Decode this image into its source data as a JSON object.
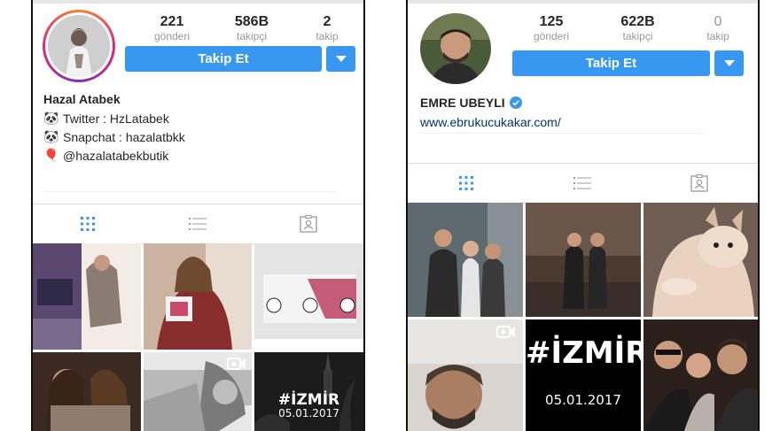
{
  "left": {
    "stats": [
      {
        "num": "221",
        "label": "gönderi"
      },
      {
        "num": "586B",
        "label": "takipçi"
      },
      {
        "num": "2",
        "label": "takip"
      }
    ],
    "follow_label": "Takip Et",
    "name": "Hazal Atabek",
    "bio": [
      {
        "icon": "🐼",
        "icon_name": "panda-icon",
        "text": "Twitter : HzLatabek"
      },
      {
        "icon": "🐼",
        "icon_name": "panda-icon",
        "text": "Snapchat : hazalatbkk"
      },
      {
        "icon": "🎈",
        "icon_name": "balloon-icon",
        "text": "@hazalatabekbutik"
      }
    ],
    "grid_text": {
      "izmir": "#İZMİR",
      "date": "05.01.2017"
    }
  },
  "right": {
    "stats": [
      {
        "num": "125",
        "label": "gönderi"
      },
      {
        "num": "622B",
        "label": "takipçi"
      },
      {
        "num": "0",
        "label": "takip"
      }
    ],
    "follow_label": "Takip Et",
    "name": "EMRE UBEYLI",
    "link": "www.ebrukucukakar.com/",
    "grid_text": {
      "izmir": "#İZMİR",
      "date": "05.01.2017"
    }
  },
  "colors": {
    "accent": "#3897f0",
    "verified": "#3897f0",
    "ring": "#e1306c",
    "link": "#003569"
  }
}
